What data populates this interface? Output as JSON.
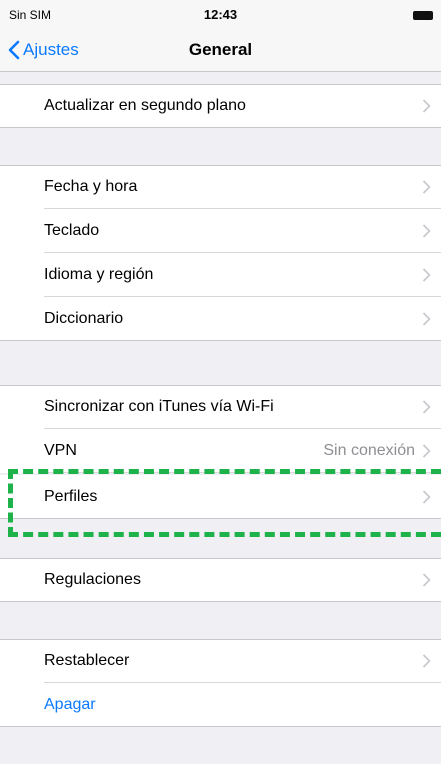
{
  "status": {
    "carrier": "Sin SIM",
    "time": "12:43",
    "battery_icon": "battery-icon"
  },
  "nav": {
    "back_label": "Ajustes",
    "title": "General"
  },
  "rows": {
    "background_refresh": "Actualizar en segundo plano",
    "date_time": "Fecha y hora",
    "keyboard": "Teclado",
    "language": "Idioma y región",
    "dictionary": "Diccionario",
    "itunes_sync": "Sincronizar con iTunes vía Wi-Fi",
    "vpn": "VPN",
    "vpn_value": "Sin conexión",
    "profiles": "Perfiles",
    "regulations": "Regulaciones",
    "reset": "Restablecer",
    "shutdown": "Apagar"
  },
  "colors": {
    "accent": "#0a7aff",
    "highlight": "#1db34a",
    "background": "#efeff4"
  }
}
